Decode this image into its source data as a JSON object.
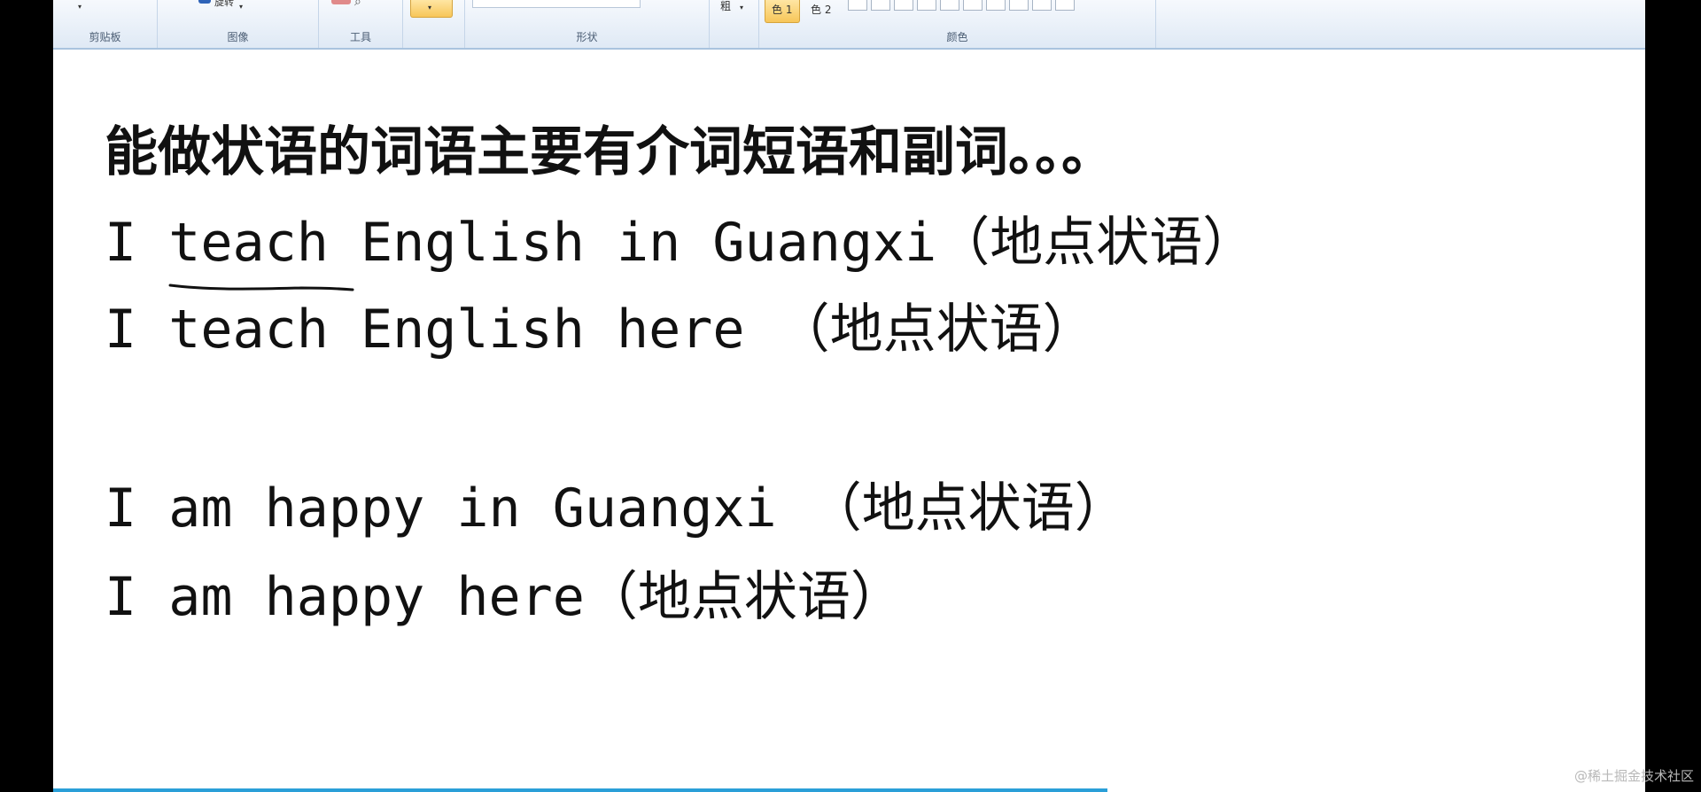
{
  "ribbon": {
    "groups": {
      "clipboard": "剪贴板",
      "image": "图像",
      "tools": "工具",
      "shapes": "形状",
      "colors": "颜色"
    },
    "rotate_label": "旋转",
    "size_label": "粗",
    "color1_label": "色 1",
    "color2_label": "色 2"
  },
  "canvas": {
    "lines": [
      "能做状语的词语主要有介词短语和副词。。。",
      "I teach English in Guangxi（地点状语）",
      "I teach English here （地点状语）",
      "I am happy in Guangxi （地点状语）",
      "I am happy here（地点状语）"
    ]
  },
  "colors": {
    "ribbon_border": "#a9c3de",
    "selected_button": "#f7c659",
    "progress": "#2a9fd8"
  },
  "watermark": "@稀土掘金技术社区"
}
